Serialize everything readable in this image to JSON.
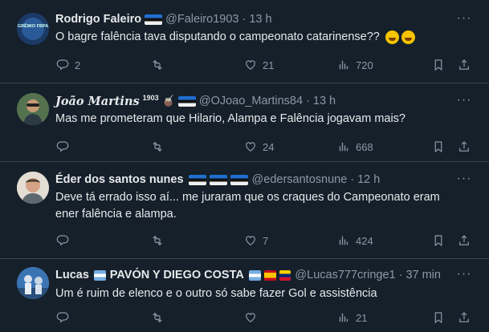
{
  "tweets": [
    {
      "name": "Rodrigo Faleiro",
      "handle": "@Faleiro1903",
      "time": "13 h",
      "text": "O bagre falência tava disputando o campeonato catarinense??",
      "avatar_text": "GRÊMIO FBPA",
      "flags": [
        "estonia-flag"
      ],
      "emojis": [
        "rolling-laughing-emoji",
        "rolling-laughing-emoji"
      ],
      "replies": "2",
      "retweets": "",
      "likes": "21",
      "views": "720"
    },
    {
      "name": "João Martins",
      "name_sup": "1903",
      "handle": "@OJoao_Martins84",
      "time": "13 h",
      "text": "Mas me prometeram que Hilario, Alampa e Falência jogavam mais?",
      "flags": [
        "mate-emoji",
        "estonia-flag"
      ],
      "replies": "",
      "retweets": "",
      "likes": "24",
      "views": "668"
    },
    {
      "name": "Éder dos santos nunes",
      "handle": "@edersantosnune",
      "time": "12 h",
      "text_lines": [
        "Deve tá errado isso aí... me juraram que os craques do Campeonato eram",
        "ener falência e alampa."
      ],
      "flags": [
        "estonia-flag",
        "estonia-flag",
        "estonia-flag"
      ],
      "replies": "",
      "retweets": "",
      "likes": "7",
      "views": "424"
    },
    {
      "name": "Lucas",
      "name_after_flag": "PAVÓN Y DIEGO COSTA",
      "handle": "@Lucas777cringe1",
      "time": "37 min",
      "text": "Um é ruim de elenco e o outro só sabe fazer Gol e assistência",
      "flags": [
        "argentina-flag",
        "spain-flag",
        "venezuela-flag"
      ],
      "replies": "",
      "retweets": "",
      "likes": "",
      "views": "21"
    }
  ],
  "more_glyph": "···",
  "colors": {
    "background": "#15202b",
    "text": "#e7e9ea",
    "muted": "#8b98a5",
    "divider": "#38444d"
  }
}
